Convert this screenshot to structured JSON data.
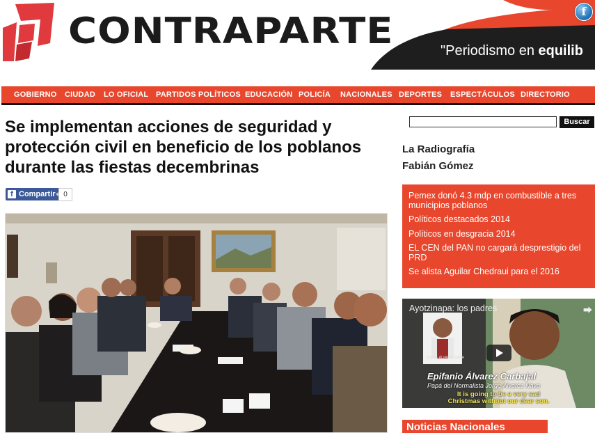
{
  "header": {
    "brand": "CONTRAPARTE",
    "slogan_start": "\"Periodismo en ",
    "slogan_bold": "equilib",
    "fb_letter": "f"
  },
  "nav": {
    "items": [
      "GOBIERNO",
      "CIUDAD",
      "LO OFICIAL",
      "PARTIDOS POLÍTICOS",
      "EDUCACIÓN",
      "POLICÍA",
      "NACIONALES",
      "DEPORTES",
      "ESPECTÁCULOS",
      "DIRECTORIO"
    ]
  },
  "article": {
    "headline": "Se implementan acciones de seguridad y protección civil en beneficio de los poblanos durante las fiestas decembrinas",
    "share_label": "Compartir",
    "share_icon_letter": "f",
    "share_count": "0"
  },
  "sidebar": {
    "search_button": "Buscar",
    "search_value": "",
    "links": [
      "La Radiografía",
      "Fabián Gómez"
    ],
    "news": [
      "Pemex donó 4.3 mdp en combustible a tres municipios poblanos",
      "Políticos destacados 2014",
      "Políticos en desgracia 2014",
      "EL CEN del PAN no cargará desprestigio del PRD",
      "Se alista Aguilar Chedraui para el 2016"
    ],
    "video": {
      "title": "Ayotzinapa: los padres",
      "name": "Epifanio Álvarez Carbajal",
      "subtitle": "Papá del Normalista Jorge Álvarez Nava",
      "caption1": "It is going to be a very sad",
      "caption2": "Christmas without our dear son.",
      "photo_label": "JORGE ÁLVAREZ NAVA"
    },
    "section_title": "Noticias Nacionales"
  },
  "colors": {
    "accent_red": "#e8472d",
    "nav_border": "#111111",
    "brand_text": "#1b1b1b"
  }
}
